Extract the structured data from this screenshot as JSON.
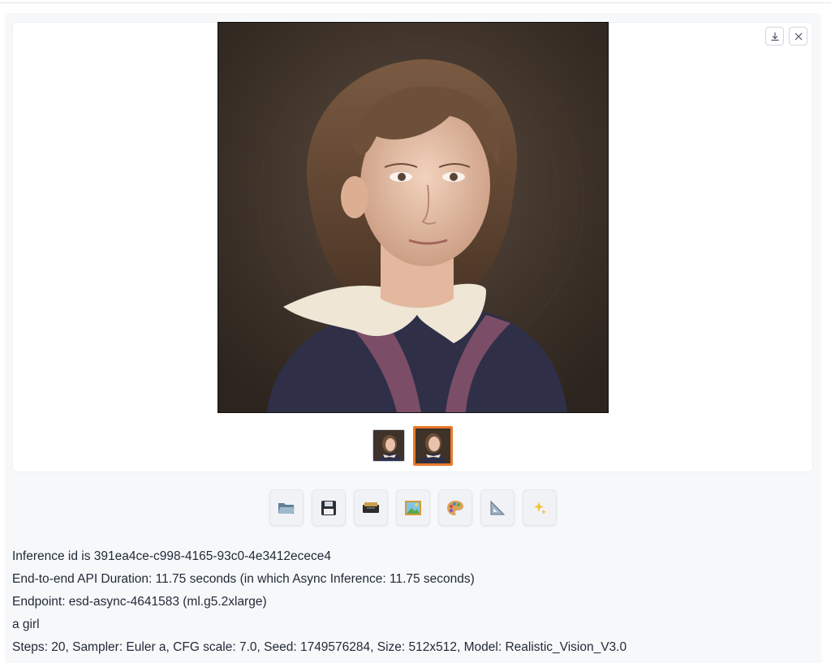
{
  "gallery": {
    "download_label": "Download",
    "close_label": "Close",
    "selected_thumbnail_index": 1,
    "thumbnail_count": 2,
    "selected_border_color": "#ea7a2b"
  },
  "toolbar": {
    "buttons": [
      {
        "name": "open-folder",
        "icon": "folder-icon"
      },
      {
        "name": "save",
        "icon": "floppy-disk-icon"
      },
      {
        "name": "zip",
        "icon": "archive-box-icon"
      },
      {
        "name": "send-to-img2img",
        "icon": "framed-picture-icon"
      },
      {
        "name": "send-to-inpaint",
        "icon": "palette-icon"
      },
      {
        "name": "send-to-extras",
        "icon": "triangular-ruler-icon"
      },
      {
        "name": "generate-variation",
        "icon": "sparkles-icon"
      }
    ]
  },
  "info": {
    "inference_id": "Inference id is 391ea4ce-c998-4165-93c0-4e3412ecece4",
    "duration": "End-to-end API Duration: 11.75 seconds (in which Async Inference: 11.75 seconds)",
    "endpoint": "Endpoint: esd-async-4641583 (ml.g5.2xlarge)",
    "prompt": "a girl",
    "params": "Steps: 20, Sampler: Euler a, CFG scale: 7.0, Seed: 1749576284, Size: 512x512, Model: Realistic_Vision_V3.0"
  }
}
